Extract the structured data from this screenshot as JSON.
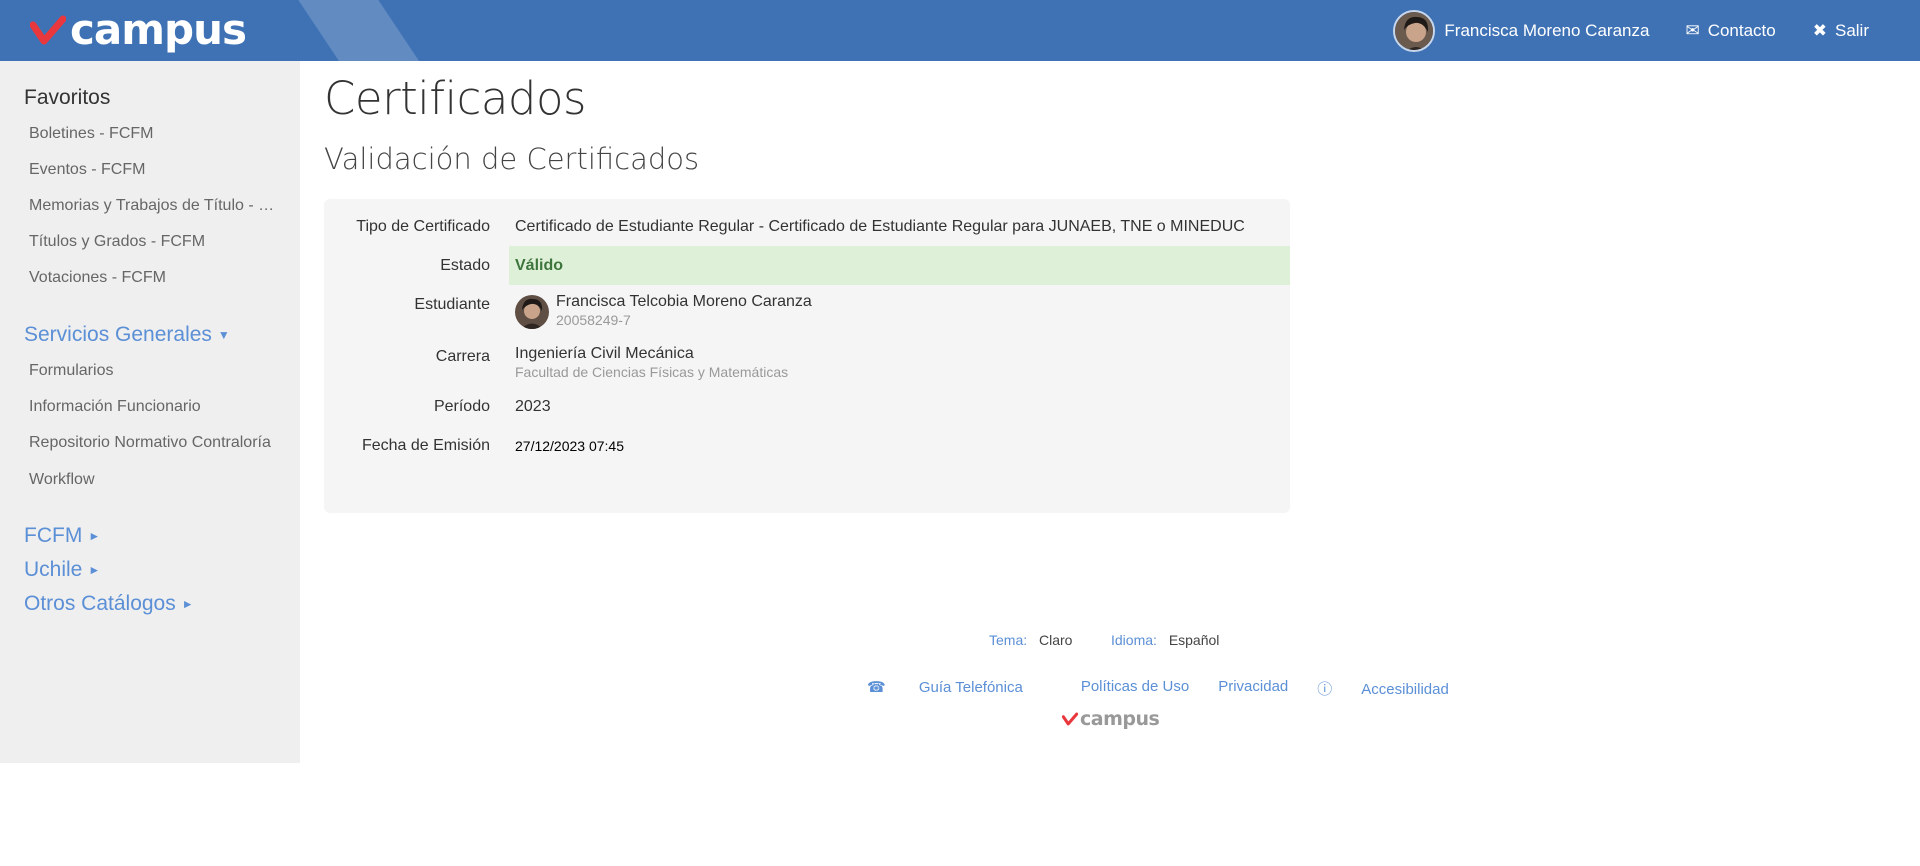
{
  "header": {
    "logo_text": "campus",
    "user_name": "Francisca Moreno Caranza",
    "contact_label": "Contacto",
    "logout_label": "Salir"
  },
  "sidebar": {
    "favorites_title": "Favoritos",
    "favorites": [
      "Boletines - FCFM",
      "Eventos - FCFM",
      "Memorias y Trabajos de Título - FCFM",
      "Títulos y Grados - FCFM",
      "Votaciones - FCFM"
    ],
    "services_title": "Servicios Generales",
    "services": [
      "Formularios",
      "Información Funcionario",
      "Repositorio Normativo Contraloría",
      "Workflow"
    ],
    "sections": [
      "FCFM",
      "Uchile",
      "Otros Catálogos"
    ]
  },
  "main": {
    "title": "Certificados",
    "subtitle": "Validación de Certificados"
  },
  "certificate": {
    "type_label": "Tipo de Certificado",
    "type_value": "Certificado de Estudiante Regular - Certificado de Estudiante Regular para JUNAEB, TNE o MINEDUC",
    "status_label": "Estado",
    "status_value": "Válido",
    "student_label": "Estudiante",
    "student_name": "Francisca Telcobia Moreno Caranza",
    "student_id": "20058249-7",
    "career_label": "Carrera",
    "career_value": "Ingeniería Civil Mecánica",
    "faculty_value": "Facultad de Ciencias Físicas y Matemáticas",
    "period_label": "Período",
    "period_value": "2023",
    "issue_label": "Fecha de Emisión",
    "issue_value": "27/12/2023 07:45"
  },
  "footer": {
    "theme_label": "Tema:",
    "theme_value": "Claro",
    "language_label": "Idioma:",
    "language_value": "Español",
    "links": [
      "Guía Telefónica",
      "Políticas de Uso",
      "Privacidad",
      "Accesibilidad"
    ],
    "logo_text": "campus"
  },
  "colors": {
    "header_bg": "#3f72b5",
    "link": "#5b8fd6",
    "valid_bg": "#dff0d8",
    "valid_text": "#3c763d",
    "accent_red": "#e8383d"
  }
}
